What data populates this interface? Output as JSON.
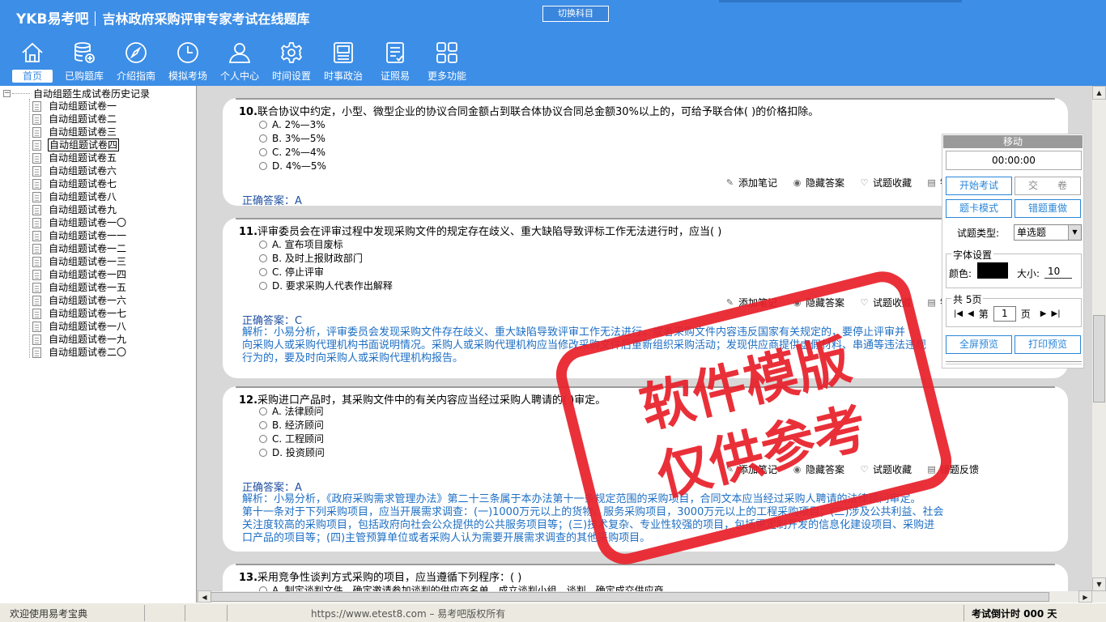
{
  "header": {
    "logo": "YKB易考吧",
    "title": "吉林政府采购评审专家考试在线题库",
    "switch_label": "切换科目",
    "nav": [
      {
        "label": "首页",
        "icon": "home-icon"
      },
      {
        "label": "已购题库",
        "icon": "database-icon"
      },
      {
        "label": "介绍指南",
        "icon": "compass-icon"
      },
      {
        "label": "模拟考场",
        "icon": "clock-icon"
      },
      {
        "label": "个人中心",
        "icon": "user-icon"
      },
      {
        "label": "时间设置",
        "icon": "gear-icon"
      },
      {
        "label": "时事政治",
        "icon": "news-icon"
      },
      {
        "label": "证照易",
        "icon": "checklist-icon"
      },
      {
        "label": "更多功能",
        "icon": "grid-icon"
      }
    ]
  },
  "tree": {
    "root": "自动组题生成试卷历史记录",
    "items": [
      "自动组题试卷一",
      "自动组题试卷二",
      "自动组题试卷三",
      "自动组题试卷四",
      "自动组题试卷五",
      "自动组题试卷六",
      "自动组题试卷七",
      "自动组题试卷八",
      "自动组题试卷九",
      "自动组题试卷一〇",
      "自动组题试卷一一",
      "自动组题试卷一二",
      "自动组题试卷一三",
      "自动组题试卷一四",
      "自动组题试卷一五",
      "自动组题试卷一六",
      "自动组题试卷一七",
      "自动组题试卷一八",
      "自动组题试卷一九",
      "自动组题试卷二〇"
    ],
    "selected_index": 3
  },
  "questions": [
    {
      "num": "10.",
      "text": "联合协议中约定，小型、微型企业的协议合同金额占到联合体协议合同总金额30%以上的，可给予联合体( )的价格扣除。",
      "options": [
        "A. 2%—3%",
        "B. 3%—5%",
        "C. 2%—4%",
        "D. 4%—5%"
      ],
      "answer": "正确答案：A",
      "explanation": []
    },
    {
      "num": "11.",
      "text": "评审委员会在评审过程中发现采购文件的规定存在歧义、重大缺陷导致评标工作无法进行时，应当( )",
      "options": [
        "A. 宣布项目废标",
        "B. 及时上报财政部门",
        "C. 停止评审",
        "D. 要求采购人代表作出解释"
      ],
      "answer": "正确答案：C",
      "explanation": [
        "解析：小易分析，评审委员会发现采购文件存在歧义、重大缺陷导致评审工作无法进行，或者采购文件内容违反国家有关规定的，要停止评审并",
        "向采购人或采购代理机构书面说明情况。采购人或采购代理机构应当修改采购文件后重新组织采购活动；发现供应商提供虚假材料、串通等违法违规",
        "行为的，要及时向采购人或采购代理机构报告。"
      ]
    },
    {
      "num": "12.",
      "text": "采购进口产品时，其采购文件中的有关内容应当经过采购人聘请的( )审定。",
      "options": [
        "A. 法律顾问",
        "B. 经济顾问",
        "C. 工程顾问",
        "D. 投资顾问"
      ],
      "answer": "正确答案：A",
      "explanation": [
        "解析：小易分析，《政府采购需求管理办法》第二十三条属于本办法第十一条规定范围的采购项目，合同文本应当经过采购人聘请的法律顾问审定。",
        "第十一条对于下列采购项目，应当开展需求调查：(一)1000万元以上的货物、服务采购项目，3000万元以上的工程采购项目；(二)涉及公共利益、社会",
        "关注度较高的采购项目，包括政府向社会公众提供的公共服务项目等；(三)技术复杂、专业性较强的项目，包括需定制开发的信息化建设项目、采购进",
        "口产品的项目等；(四)主管预算单位或者采购人认为需要开展需求调查的其他采购项目。"
      ]
    },
    {
      "num": "13.",
      "text": "采用竞争性谈判方式采购的项目，应当遵循下列程序：( )",
      "options": [
        "A. 制定谈判文件、确定邀请参加谈判的供应商名单、成立谈判小组、谈判、确定成交供应商"
      ],
      "answer": "",
      "explanation": []
    }
  ],
  "actions": {
    "note": "添加笔记",
    "hide": "隐藏答案",
    "fav": "试题收藏",
    "feedback": "错题反馈"
  },
  "panel": {
    "title": "移动",
    "timer": "00:00:00",
    "start": "开始考试",
    "submit": "交　　卷",
    "card_mode": "题卡模式",
    "redo": "错题重做",
    "qtype_label": "试题类型:",
    "qtype_value": "单选题",
    "font_group": "字体设置",
    "color_label": "颜色:",
    "size_label": "大小:",
    "size_value": "10",
    "pages_label": "共 5页",
    "page_prefix": "第",
    "page_value": "1",
    "page_suffix": "页",
    "fullscreen": "全屏预览",
    "print": "打印预览"
  },
  "watermark": {
    "line1": "软件模版",
    "line2": "仅供参考"
  },
  "status": {
    "welcome": "欢迎使用易考宝典",
    "url": "https://www.etest8.com – 易考吧版权所有",
    "countdown": "考试倒计时 000 天"
  }
}
